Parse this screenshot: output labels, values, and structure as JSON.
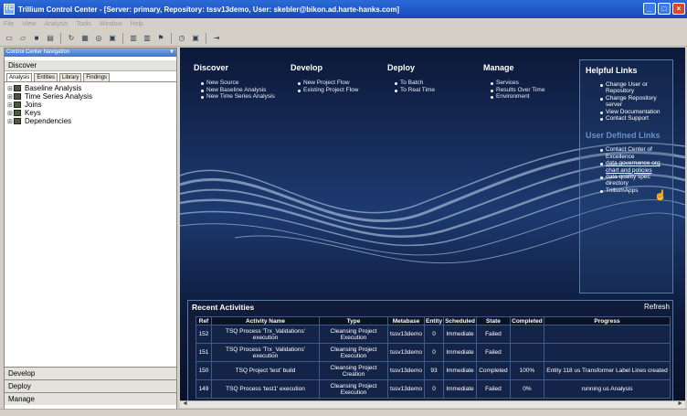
{
  "window": {
    "title": "Trillium Control Center - [Server: primary, Repository: tssv13demo, User: skebler@bikon.ad.harte-hanks.com]"
  },
  "menu": [
    "File",
    "View",
    "Analysis",
    "Tools",
    "Window",
    "Help"
  ],
  "left_panel": {
    "header": "Control Center Navigation",
    "discover_label": "Discover",
    "tabs": [
      "Analysis",
      "Entities",
      "Library",
      "Findings"
    ],
    "tree": [
      "Baseline Analysis",
      "Time Series Analysis",
      "Joins",
      "Keys",
      "Dependencies"
    ],
    "accordions": [
      "Develop",
      "Deploy",
      "Manage"
    ]
  },
  "columns": [
    {
      "title": "Discover",
      "items": [
        "New Source",
        "New Baseline Analysis",
        "New Time Series Analysis"
      ]
    },
    {
      "title": "Develop",
      "items": [
        "New Project Flow",
        "Existing Project Flow"
      ]
    },
    {
      "title": "Deploy",
      "items": [
        "To Batch",
        "To Real Time"
      ]
    },
    {
      "title": "Manage",
      "items": [
        "Services",
        "Results Over Time",
        "Environment"
      ]
    }
  ],
  "helpful": {
    "title": "Helpful Links",
    "items": [
      "Change User or Repository",
      "Change Repository server",
      "View Documentation",
      "Contact Support"
    ],
    "ud_title": "User Defined Links",
    "ud_items": [
      "Contact Center of Excellence",
      "data governance org chart and policies",
      "data quality spec directory",
      "TrilliumApps"
    ]
  },
  "recent": {
    "title": "Recent Activities",
    "refresh": "Refresh",
    "headers": [
      "Ref",
      "Activity Name",
      "Type",
      "Metabase",
      "Entity",
      "Scheduled",
      "State",
      "Completed",
      "Progress"
    ],
    "rows": [
      [
        "152",
        "TSQ Process 'Trx_Validations' execution",
        "Cleansing Project Execution",
        "tssv13demo",
        "0",
        "Immediate",
        "Failed",
        "",
        ""
      ],
      [
        "151",
        "TSQ Process 'Trx_Validations' execution",
        "Cleansing Project Execution",
        "tssv13demo",
        "0",
        "Immediate",
        "Failed",
        "",
        ""
      ],
      [
        "150",
        "TSQ Project 'test' build",
        "Cleansing Project Creation",
        "tssv13demo",
        "93",
        "Immediate",
        "Completed",
        "100%",
        "Entity 118 us Transformer Label Lines created"
      ],
      [
        "149",
        "TSQ Process 'test1' execution",
        "Cleansing Project Execution",
        "tssv13demo",
        "0",
        "Immediate",
        "Failed",
        "0%",
        "running us Analysis"
      ]
    ]
  }
}
